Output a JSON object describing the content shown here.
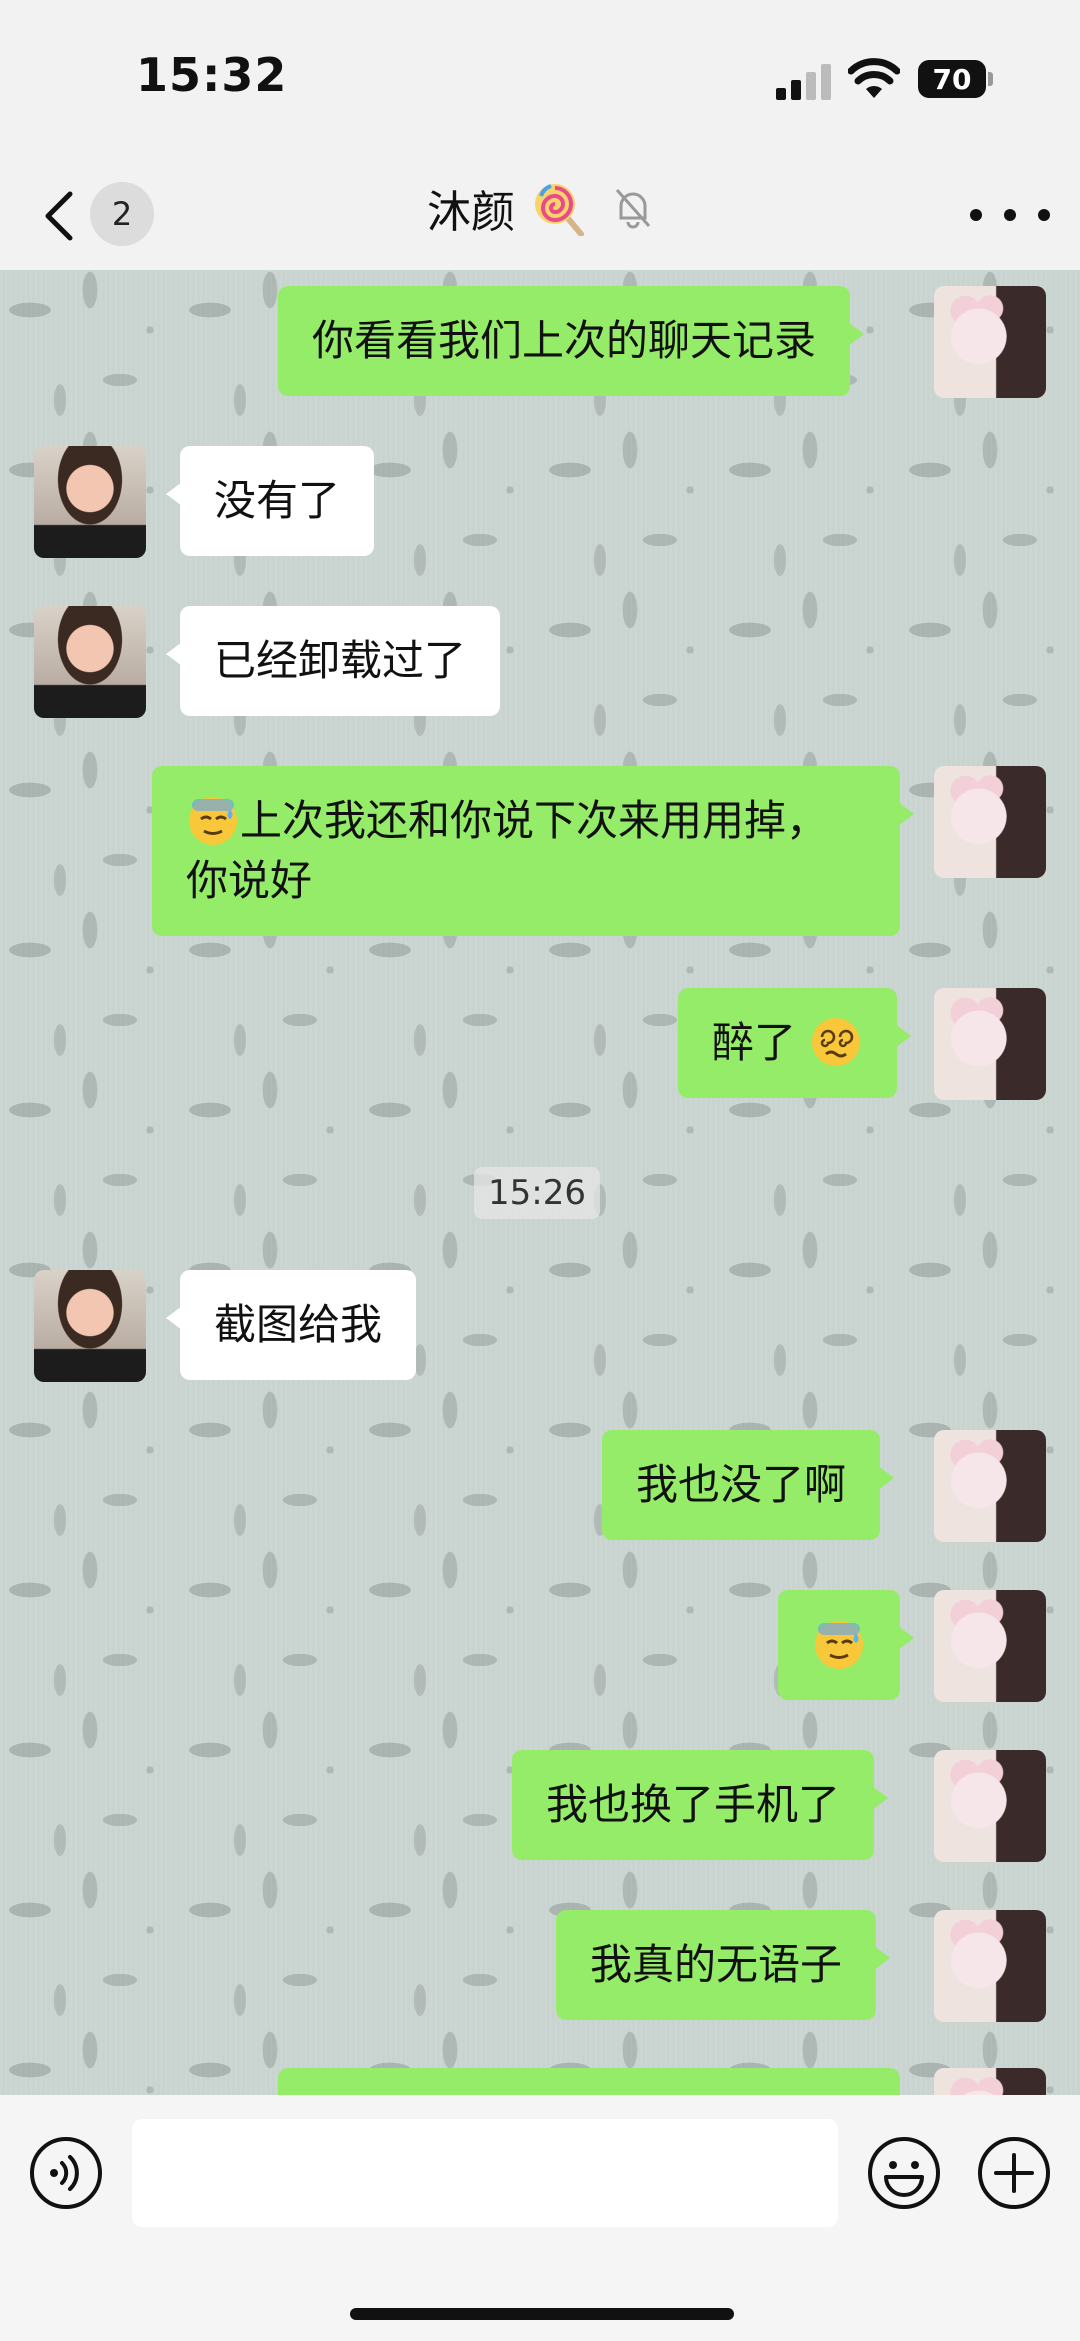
{
  "status_bar": {
    "time": "15:32",
    "battery": "70"
  },
  "header": {
    "unread_count": "2",
    "title": "沐颜",
    "title_emoji": "lollipop-icon",
    "muted_icon": "bell-off-icon"
  },
  "messages": [
    {
      "side": "out",
      "text": "你看看我们上次的聊天记录"
    },
    {
      "side": "in",
      "text": "没有了"
    },
    {
      "side": "in",
      "text": "已经卸载过了"
    },
    {
      "side": "out",
      "text": "上次我还和你说下次来用用掉，你说好",
      "emoji": "sweat-smile-icon"
    },
    {
      "side": "out",
      "text": "醉了",
      "emoji": "dizzy-face-icon"
    },
    {
      "side": "time",
      "text": "15:26"
    },
    {
      "side": "in",
      "text": "截图给我"
    },
    {
      "side": "out",
      "text": "我也没了啊"
    },
    {
      "side": "out",
      "text": "",
      "emoji": "sweat-smile-icon"
    },
    {
      "side": "out",
      "text": "我也换了手机了"
    },
    {
      "side": "out",
      "text": "我真的无语子"
    }
  ],
  "colors": {
    "outgoing_bubble": "#95ec69",
    "incoming_bubble": "#ffffff"
  },
  "input": {
    "placeholder": ""
  }
}
